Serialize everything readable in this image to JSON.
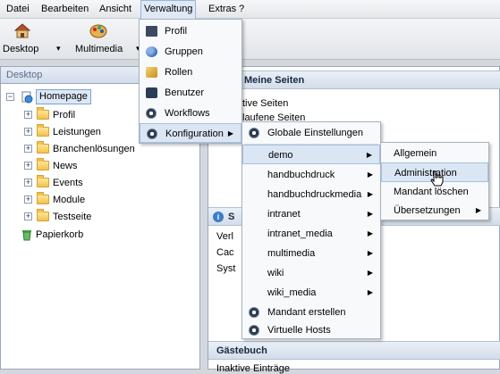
{
  "menubar": {
    "items": [
      "Datei",
      "Bearbeiten",
      "Ansicht",
      "Verwaltung",
      "Extras",
      "?"
    ]
  },
  "toolbar": {
    "desktop_label": "Desktop",
    "multimedia_label": "Multimedia"
  },
  "left_panel": {
    "title": "Desktop",
    "root": "Homepage",
    "children": [
      "Profil",
      "Leistungen",
      "Branchenlösungen",
      "News",
      "Events",
      "Module",
      "Testseite"
    ],
    "trash": "Papierkorb"
  },
  "main": {
    "meine_seiten_title": "Meine Seiten",
    "meine_seiten_lines": [
      "tive Seiten",
      "laufene Seiten"
    ],
    "system_title_frag": "S",
    "system_lines": [
      "Verl",
      "Cac",
      "Syst"
    ],
    "gaestebuch_title": "Gästebuch",
    "gaestebuch_line": "Inaktive Einträge"
  },
  "verwaltung_menu": {
    "items": [
      "Profil",
      "Gruppen",
      "Rollen",
      "Benutzer",
      "Workflows",
      "Konfiguration"
    ]
  },
  "konfiguration_menu": {
    "items": [
      "Globale Einstellungen",
      "demo",
      "handbuchdruck",
      "handbuchdruckmedia",
      "intranet",
      "intranet_media",
      "multimedia",
      "wiki",
      "wiki_media",
      "Mandant erstellen",
      "Virtuelle Hosts"
    ]
  },
  "demo_menu": {
    "items": [
      "Allgemein",
      "Administration",
      "Mandant löschen",
      "Übersetzungen"
    ]
  }
}
